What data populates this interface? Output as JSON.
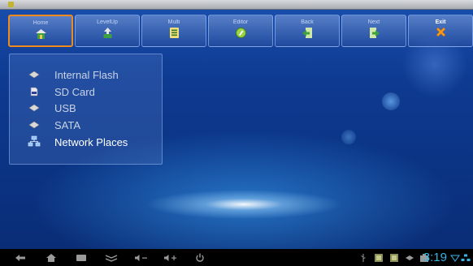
{
  "toolbar": {
    "buttons": [
      {
        "label": "Home",
        "icon": "home-icon"
      },
      {
        "label": "LevelUp",
        "icon": "level-up-icon"
      },
      {
        "label": "Multi",
        "icon": "multi-select-icon"
      },
      {
        "label": "Editor",
        "icon": "editor-icon"
      },
      {
        "label": "Back",
        "icon": "back-arrow-icon"
      },
      {
        "label": "Next",
        "icon": "next-arrow-icon"
      },
      {
        "label": "Exit",
        "icon": "exit-x-icon"
      }
    ],
    "active": "Home"
  },
  "locations": [
    {
      "label": "Internal Flash",
      "icon": "flash-drive-icon"
    },
    {
      "label": "SD Card",
      "icon": "sd-card-icon"
    },
    {
      "label": "USB",
      "icon": "usb-drive-icon"
    },
    {
      "label": "SATA",
      "icon": "sata-drive-icon"
    },
    {
      "label": "Network Places",
      "icon": "network-places-icon"
    }
  ],
  "selected_location": "Network Places",
  "status": {
    "time": "3:19"
  },
  "colors": {
    "accent": "#33b5e5",
    "active_border": "#f08a1c",
    "background": "#0e3a91"
  }
}
